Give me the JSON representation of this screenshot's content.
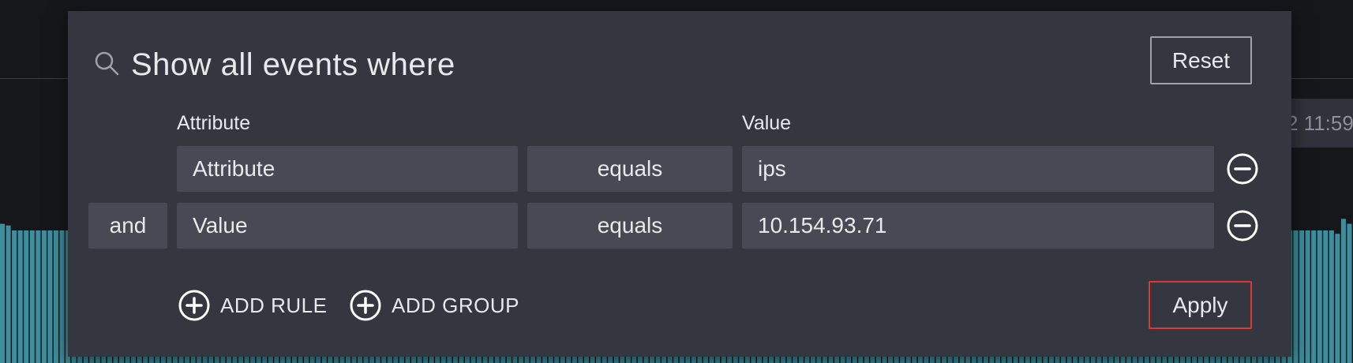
{
  "background": {
    "time_label": "2 11:59",
    "histogram_color": "#3b8f9e",
    "histogram_levels": [
      0.84,
      0.83,
      0.8,
      0.8,
      0.8,
      0.8,
      0.8,
      0.8,
      0.8,
      0.8,
      0.8,
      0.8,
      0.8,
      0.8,
      0.8,
      0.8,
      0.8,
      0.8,
      0.8,
      0.8,
      0.8,
      0.8,
      0.8,
      0.8,
      0.8,
      0.8,
      0.8,
      0.8,
      0.8,
      0.8,
      0.8,
      0.8,
      0.8,
      0.8,
      0.8,
      0.8,
      0.8,
      0.8,
      0.8,
      0.8,
      0.8,
      0.8,
      0.8,
      0.8,
      0.8,
      0.8,
      0.8,
      0.8,
      0.8,
      0.8,
      0.8,
      0.8,
      0.8,
      0.8,
      0.8,
      0.8,
      0.8,
      0.8,
      0.8,
      0.8,
      0.8,
      0.8,
      0.8,
      0.8,
      0.8,
      0.8,
      0.8,
      0.8,
      0.8,
      0.8,
      0.8,
      0.8,
      0.8,
      0.8,
      0.8,
      0.8,
      0.8,
      0.8,
      0.8,
      0.8,
      0.8,
      0.8,
      0.8,
      0.8,
      0.8,
      0.8,
      0.8,
      0.8,
      0.8,
      0.8,
      0.8,
      0.8,
      0.8,
      0.8,
      0.8,
      0.8,
      0.8,
      0.8,
      0.8,
      0.8,
      0.8,
      0.8,
      0.8,
      0.8,
      0.8,
      0.8,
      0.8,
      0.8,
      0.8,
      0.8,
      0.8,
      0.8,
      0.8,
      0.8,
      0.8,
      0.8,
      0.8,
      0.8,
      0.8,
      0.8,
      0.8,
      0.8,
      0.8,
      0.8,
      0.8,
      0.8,
      0.8,
      0.8,
      0.8,
      0.8,
      0.8,
      0.8,
      0.8,
      0.8,
      0.8,
      0.8,
      0.8,
      0.8,
      0.8,
      0.8,
      0.8,
      0.8,
      0.8,
      0.8,
      0.8,
      0.8,
      0.8,
      0.8,
      0.8,
      0.8,
      0.8,
      0.8,
      0.8,
      0.8,
      0.8,
      0.8,
      0.8,
      0.8,
      0.8,
      0.8,
      0.8,
      0.8,
      0.8,
      0.8,
      0.8,
      0.8,
      0.8,
      0.8,
      0.8,
      0.8,
      0.8,
      0.8,
      0.8,
      0.8,
      0.8,
      0.8,
      0.8,
      0.8,
      0.8,
      0.8,
      0.8,
      0.8,
      0.8,
      0.8,
      0.8,
      0.8,
      0.8,
      0.8,
      0.8,
      0.8,
      0.8,
      0.8,
      0.8,
      0.8,
      0.8,
      0.8,
      0.8,
      0.8,
      0.8,
      0.8,
      0.8,
      0.8,
      0.8,
      0.8,
      0.8,
      0.8,
      0.8,
      0.8,
      0.8,
      0.8,
      0.8,
      0.8,
      0.8,
      0.8,
      0.8,
      0.8,
      0.8,
      0.8,
      0.8,
      0.8,
      0.8,
      0.8,
      0.8,
      0.8,
      0.78,
      0.87,
      0.84
    ]
  },
  "filter": {
    "title": "Show all events where",
    "reset_label": "Reset",
    "apply_label": "Apply",
    "columns": {
      "attribute": "Attribute",
      "value": "Value"
    },
    "rules": [
      {
        "combinator": "",
        "attribute": "Attribute",
        "operator": "equals",
        "value": "ips"
      },
      {
        "combinator": "and",
        "attribute": "Value",
        "operator": "equals",
        "value": "10.154.93.71"
      }
    ],
    "add_rule_label": "ADD RULE",
    "add_group_label": "ADD GROUP",
    "colors": {
      "dialog_bg": "#343740",
      "field_bg": "#474a55",
      "apply_border": "#d9392f"
    }
  }
}
